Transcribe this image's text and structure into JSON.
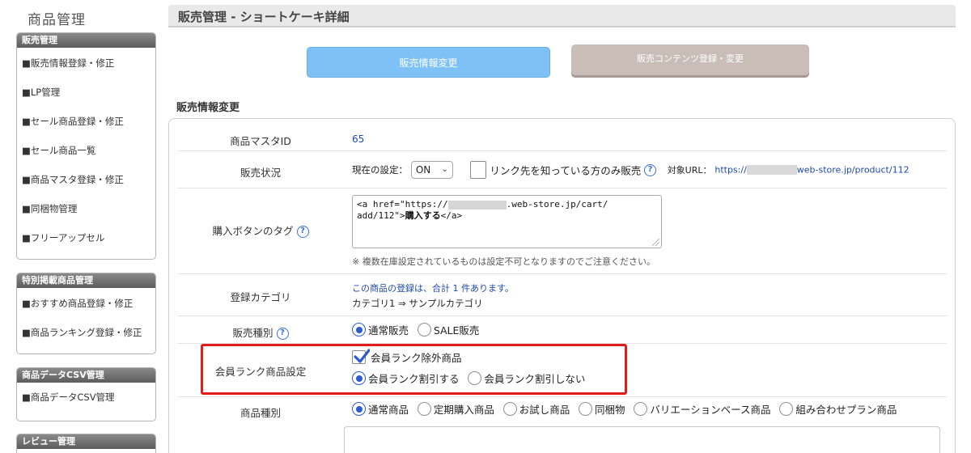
{
  "sidebar": {
    "title": "商品管理",
    "groups": [
      {
        "header": "販売管理",
        "items": [
          "■販売情報登録・修正",
          "■LP管理",
          "■セール商品登録・修正",
          "■セール商品一覧",
          "■商品マスタ登録・修正",
          "■同梱物管理",
          "■フリーアップセル"
        ]
      },
      {
        "header": "特別掲載商品管理",
        "items": [
          "■おすすめ商品登録・修正",
          "■商品ランキング登録・修正"
        ]
      },
      {
        "header": "商品データCSV管理",
        "items": [
          "■商品データCSV管理"
        ]
      },
      {
        "header": "レビュー管理",
        "items": []
      }
    ]
  },
  "header": {
    "title": "販売管理 - ショートケーキ詳細"
  },
  "tabs": {
    "active": "販売情報変更",
    "inactive": "販売コンテンツ登録・変更"
  },
  "section": {
    "title": "販売情報変更"
  },
  "form": {
    "master_id": {
      "label": "商品マスタID",
      "value": "65"
    },
    "sale_status": {
      "label": "販売状況",
      "current_label": "現在の設定：",
      "select_value": "ON",
      "link_only_label": "リンク先を知っている方のみ販売",
      "url_label": "対象URL：",
      "url_prefix": "https://",
      "url_suffix": "web-store.jp/product/112"
    },
    "button_tag": {
      "label": "購入ボタンのタグ",
      "code_line1_a": "<a href=\"https://",
      "code_line1_b": ".web-store.jp/cart/",
      "code_line2_a": "add/112\">",
      "code_bold": "購入する",
      "code_line2_b": "</a>",
      "note": "※ 複数在庫設定されているものは設定不可となりますのでご注意ください。"
    },
    "category": {
      "label": "登録カテゴリ",
      "count_text": "この商品の登録は、合計 1 件あります。",
      "path": "カテゴリ1 ⇒ サンプルカテゴリ"
    },
    "sale_type": {
      "label": "販売種別",
      "options": [
        "通常販売",
        "SALE販売"
      ],
      "selected": 0
    },
    "member_rank": {
      "label": "会員ランク商品設定",
      "exclude_label": "会員ランク除外商品",
      "exclude_checked": true,
      "options": [
        "会員ランク割引する",
        "会員ランク割引しない"
      ],
      "selected": 0
    },
    "product_type": {
      "label": "商品種別",
      "options": [
        "通常商品",
        "定期購入商品",
        "お試し商品",
        "同梱物",
        "バリエーションベース商品",
        "組み合わせプラン商品"
      ],
      "selected": 0
    }
  },
  "colors": {
    "accent": "#2f5bd1",
    "active_tab": "#7ec1f6",
    "inactive_tab": "#c9bdb8",
    "highlight": "#e21b1b"
  }
}
